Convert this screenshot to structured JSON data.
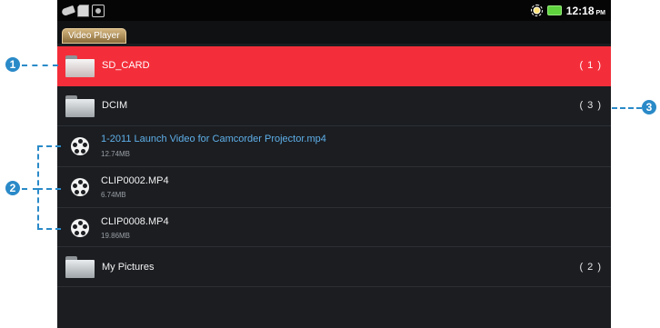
{
  "status_bar": {
    "left_icons": [
      "usb-icon",
      "sd-card-icon",
      "debug-icon"
    ],
    "right_icons": [
      "brightness-icon",
      "battery-icon"
    ],
    "time": "12:18",
    "ampm": "PM"
  },
  "app": {
    "tab_label": "Video Player"
  },
  "rows": [
    {
      "type": "folder",
      "name": "SD_CARD",
      "count": "( 1 )",
      "selected": true
    },
    {
      "type": "folder",
      "name": "DCIM",
      "count": "( 3 )"
    },
    {
      "type": "video",
      "name": "1-2011 Launch Video for Camcorder Projector.mp4",
      "size": "12.74MB",
      "highlighted": true
    },
    {
      "type": "video",
      "name": "CLIP0002.MP4",
      "size": "6.74MB"
    },
    {
      "type": "video",
      "name": "CLIP0008.MP4",
      "size": "19.86MB"
    },
    {
      "type": "folder",
      "name": "My Pictures",
      "count": "( 2 )"
    }
  ],
  "callouts": [
    "1",
    "2",
    "3"
  ],
  "colors": {
    "selected_row": "#f32e3a",
    "highlight_text": "#5fb0ea",
    "callout": "#2a8ac8"
  }
}
